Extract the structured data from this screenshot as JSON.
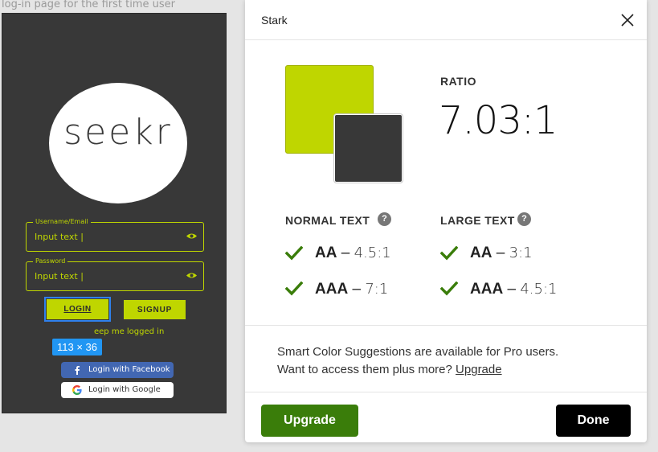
{
  "canvas": {
    "frame_label": "log-in page for the first time user",
    "logo_text": "seekr",
    "username_label": "Username/Email",
    "username_placeholder": "Input text",
    "password_label": "Password",
    "password_placeholder": "Input text",
    "login_label": "LOGIN",
    "signup_label": "SIGNUP",
    "keep_logged_in": "eep me logged in",
    "selection_size": "113 × 36",
    "facebook_label": "Login with Facebook",
    "google_label": "Login with Google",
    "colors": {
      "frame_bg": "#383838",
      "accent": "#bfd600",
      "selection": "#2196f3",
      "facebook": "#4267b2"
    }
  },
  "stark": {
    "title": "Stark",
    "ratio_label": "RATIO",
    "ratio_value": "7.03:1",
    "swatches": {
      "foreground": "#bfd600",
      "background": "#383838"
    },
    "normal_text": {
      "heading": "NORMAL TEXT",
      "aa": {
        "level": "AA",
        "sep": "–",
        "value": "4.5:1",
        "pass": true
      },
      "aaa": {
        "level": "AAA",
        "sep": "–",
        "value": "7:1",
        "pass": true
      }
    },
    "large_text": {
      "heading": "LARGE TEXT",
      "aa": {
        "level": "AA",
        "sep": "–",
        "value": "3:1",
        "pass": true
      },
      "aaa": {
        "level": "AAA",
        "sep": "–",
        "value": "4.5:1",
        "pass": true
      }
    },
    "help_glyph": "?",
    "promo_line1": "Smart Color Suggestions are available for Pro users.",
    "promo_line2": "Want to access them plus more?",
    "promo_link": "Upgrade",
    "upgrade_button": "Upgrade",
    "done_button": "Done",
    "colors": {
      "pass_check": "#3a7d0a",
      "upgrade_bg": "#3a7d0a",
      "done_bg": "#000000"
    }
  }
}
